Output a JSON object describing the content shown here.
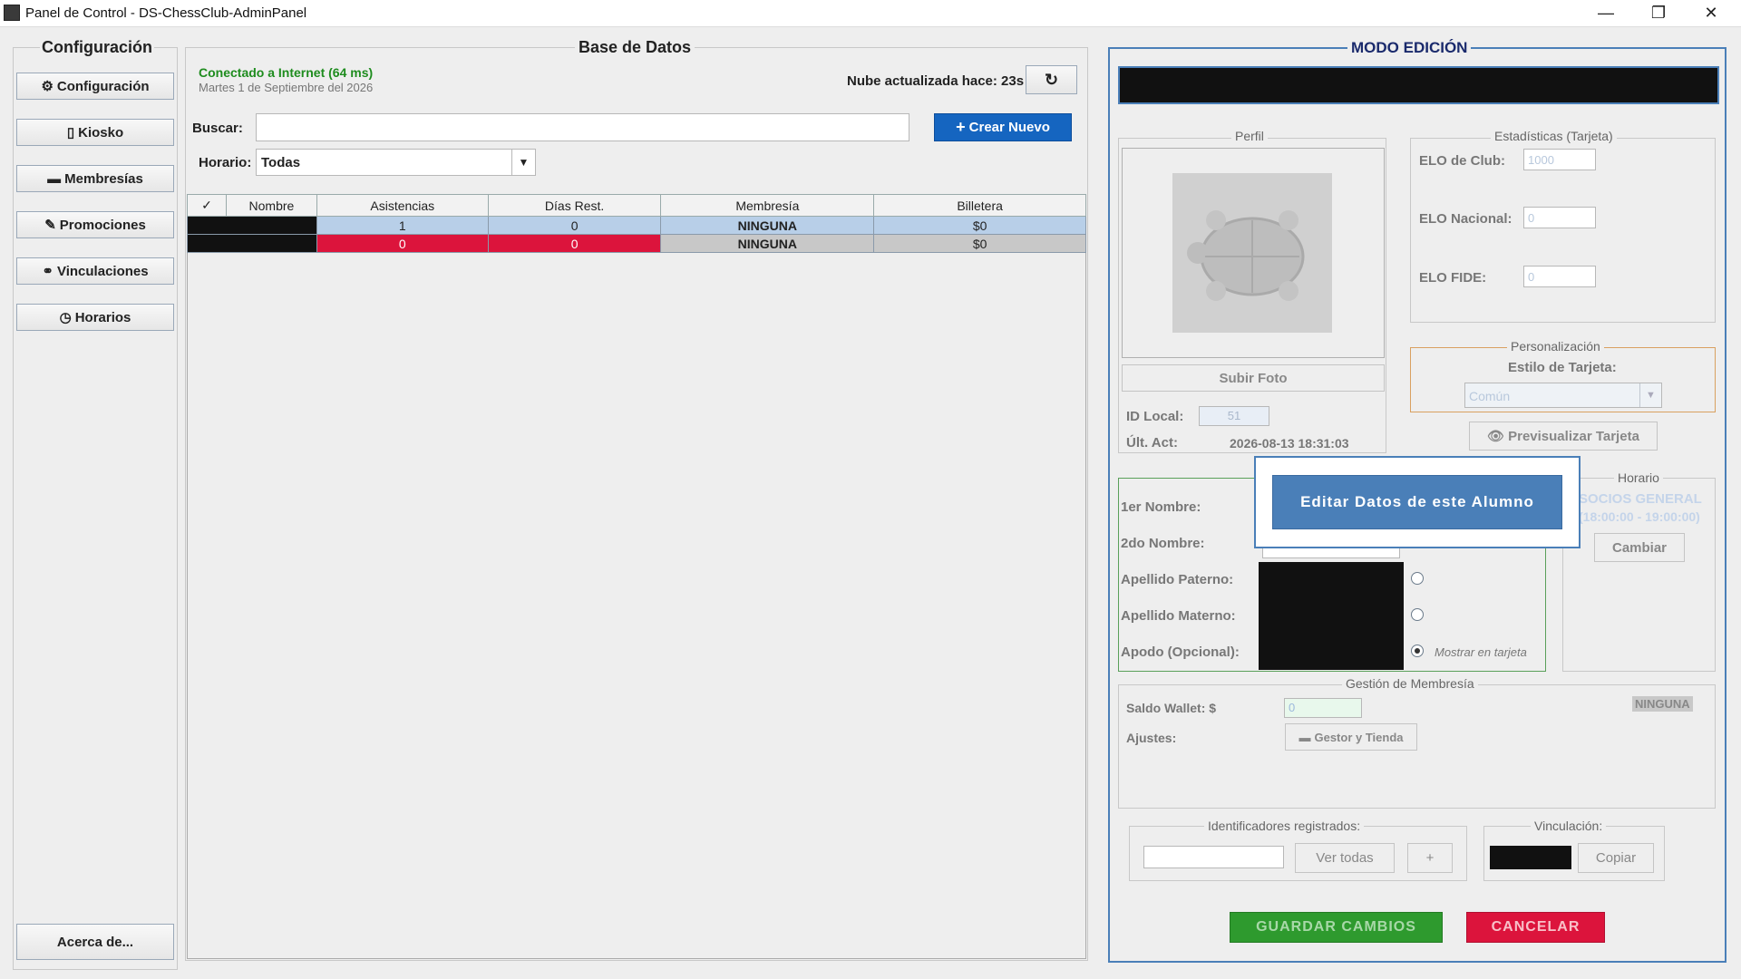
{
  "window": {
    "title": "Panel de Control - DS-ChessClub-AdminPanel",
    "minimize_icon": "minimize-icon",
    "restore_icon": "restore-icon",
    "close_icon": "close-icon"
  },
  "sidebar": {
    "title": "Configuración",
    "items": [
      {
        "icon": "⚙",
        "label": "Configuración"
      },
      {
        "icon": "▯",
        "label": "Kiosko"
      },
      {
        "icon": "▬",
        "label": "Membresías"
      },
      {
        "icon": "✎",
        "label": "Promociones"
      },
      {
        "icon": "⚭",
        "label": "Vinculaciones"
      },
      {
        "icon": "◷",
        "label": "Horarios"
      }
    ],
    "about_label": "Acerca de..."
  },
  "database": {
    "title": "Base de Datos",
    "connection_status": "Conectado a Internet (64 ms)",
    "date": "Martes 1 de Septiembre del 2026",
    "cloud_status": "Nube actualizada hace: 23s",
    "refresh_icon": "↻",
    "search_label": "Buscar:",
    "search_value": "",
    "create_label": "Crear Nuevo",
    "schedule_label": "Horario:",
    "schedule_value": "Todas",
    "table": {
      "headers": [
        "✓",
        "Nombre",
        "Asistencias",
        "Días Rest.",
        "Membresía",
        "Billetera"
      ],
      "rows": [
        {
          "name": "",
          "asistencias": "1",
          "dias": "0",
          "membresia": "NINGUNA",
          "billetera": "$0"
        },
        {
          "name": "",
          "asistencias": "0",
          "dias": "0",
          "membresia": "NINGUNA",
          "billetera": "$0"
        }
      ]
    }
  },
  "edit": {
    "mode_title": "MODO EDICIÓN",
    "profile": {
      "title": "Perfil",
      "upload_label": "Subir Foto",
      "id_label": "ID Local:",
      "id_value": "51",
      "last_update_label": "Últ. Act:",
      "last_update_value": "2026-08-13 18:31:03"
    },
    "stats": {
      "title": "Estadísticas (Tarjeta)",
      "club_label": "ELO de Club:",
      "club_value": "1000",
      "national_label": "ELO Nacional:",
      "national_value": "0",
      "fide_label": "ELO FIDE:",
      "fide_value": "0"
    },
    "personalization": {
      "title": "Personalización",
      "style_label": "Estilo de Tarjeta:",
      "style_value": "Común",
      "preview_label": "Previsualizar Tarjeta"
    },
    "overlay_button": "Editar Datos de este Alumno",
    "names": {
      "first_label": "1er Nombre:",
      "second_label": "2do Nombre:",
      "paternal_label": "Apellido Paterno:",
      "maternal_label": "Apellido Materno:",
      "nickname_label": "Apodo (Opcional):",
      "show_on_card": "Mostrar en tarjeta"
    },
    "schedule": {
      "title": "Horario",
      "name": "SOCIOS GENERAL",
      "time": "(18:00:00 - 19:00:00)",
      "change_label": "Cambiar"
    },
    "membership": {
      "title": "Gestión de Membresía",
      "wallet_label": "Saldo Wallet: $",
      "wallet_value": "0",
      "adjust_label": "Ajustes:",
      "store_label": "Gestor y Tienda",
      "badge": "NINGUNA"
    },
    "identifiers": {
      "title": "Identificadores registrados:",
      "view_all": "Ver todas",
      "add": "+"
    },
    "link": {
      "title": "Vinculación:",
      "copy": "Copiar"
    },
    "save_label": "GUARDAR CAMBIOS",
    "cancel_label": "CANCELAR"
  },
  "colors": {
    "accent_blue": "#1565c0",
    "status_green": "#1e8c1e",
    "row_selected": "#b8cfe8",
    "row_alert": "#dc143c",
    "save_green": "#2e9a2e",
    "cancel_red": "#dc143c",
    "overlay_blue": "#4a7fb8"
  }
}
